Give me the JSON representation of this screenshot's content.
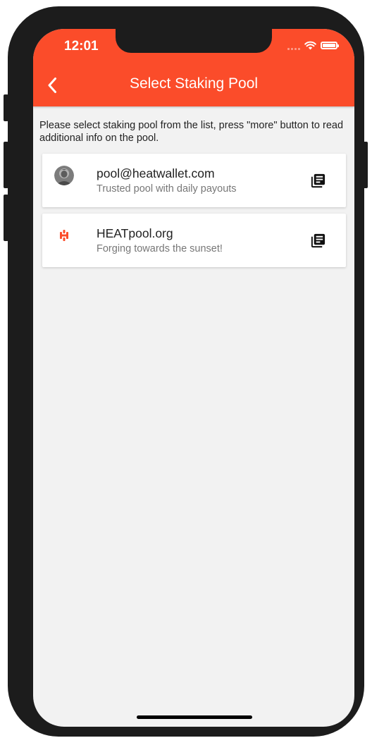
{
  "status_bar": {
    "time": "12:01"
  },
  "header": {
    "title": "Select Staking Pool",
    "back_icon": "chevron-left-icon"
  },
  "intro": "Please select staking pool from the list, press \"more\" button to read additional info on the pool.",
  "pools": [
    {
      "name": "pool@heatwallet.com",
      "description": "Trusted pool with daily payouts",
      "icon": "avatar-photo",
      "action_icon": "library-books-icon"
    },
    {
      "name": "HEATpool.org",
      "description": "Forging towards the sunset!",
      "icon": "heat-logo",
      "action_icon": "library-books-icon"
    }
  ],
  "colors": {
    "accent": "#fb4c2a",
    "background": "#f2f2f2",
    "card": "#ffffff",
    "frame": "#1c1c1c"
  }
}
